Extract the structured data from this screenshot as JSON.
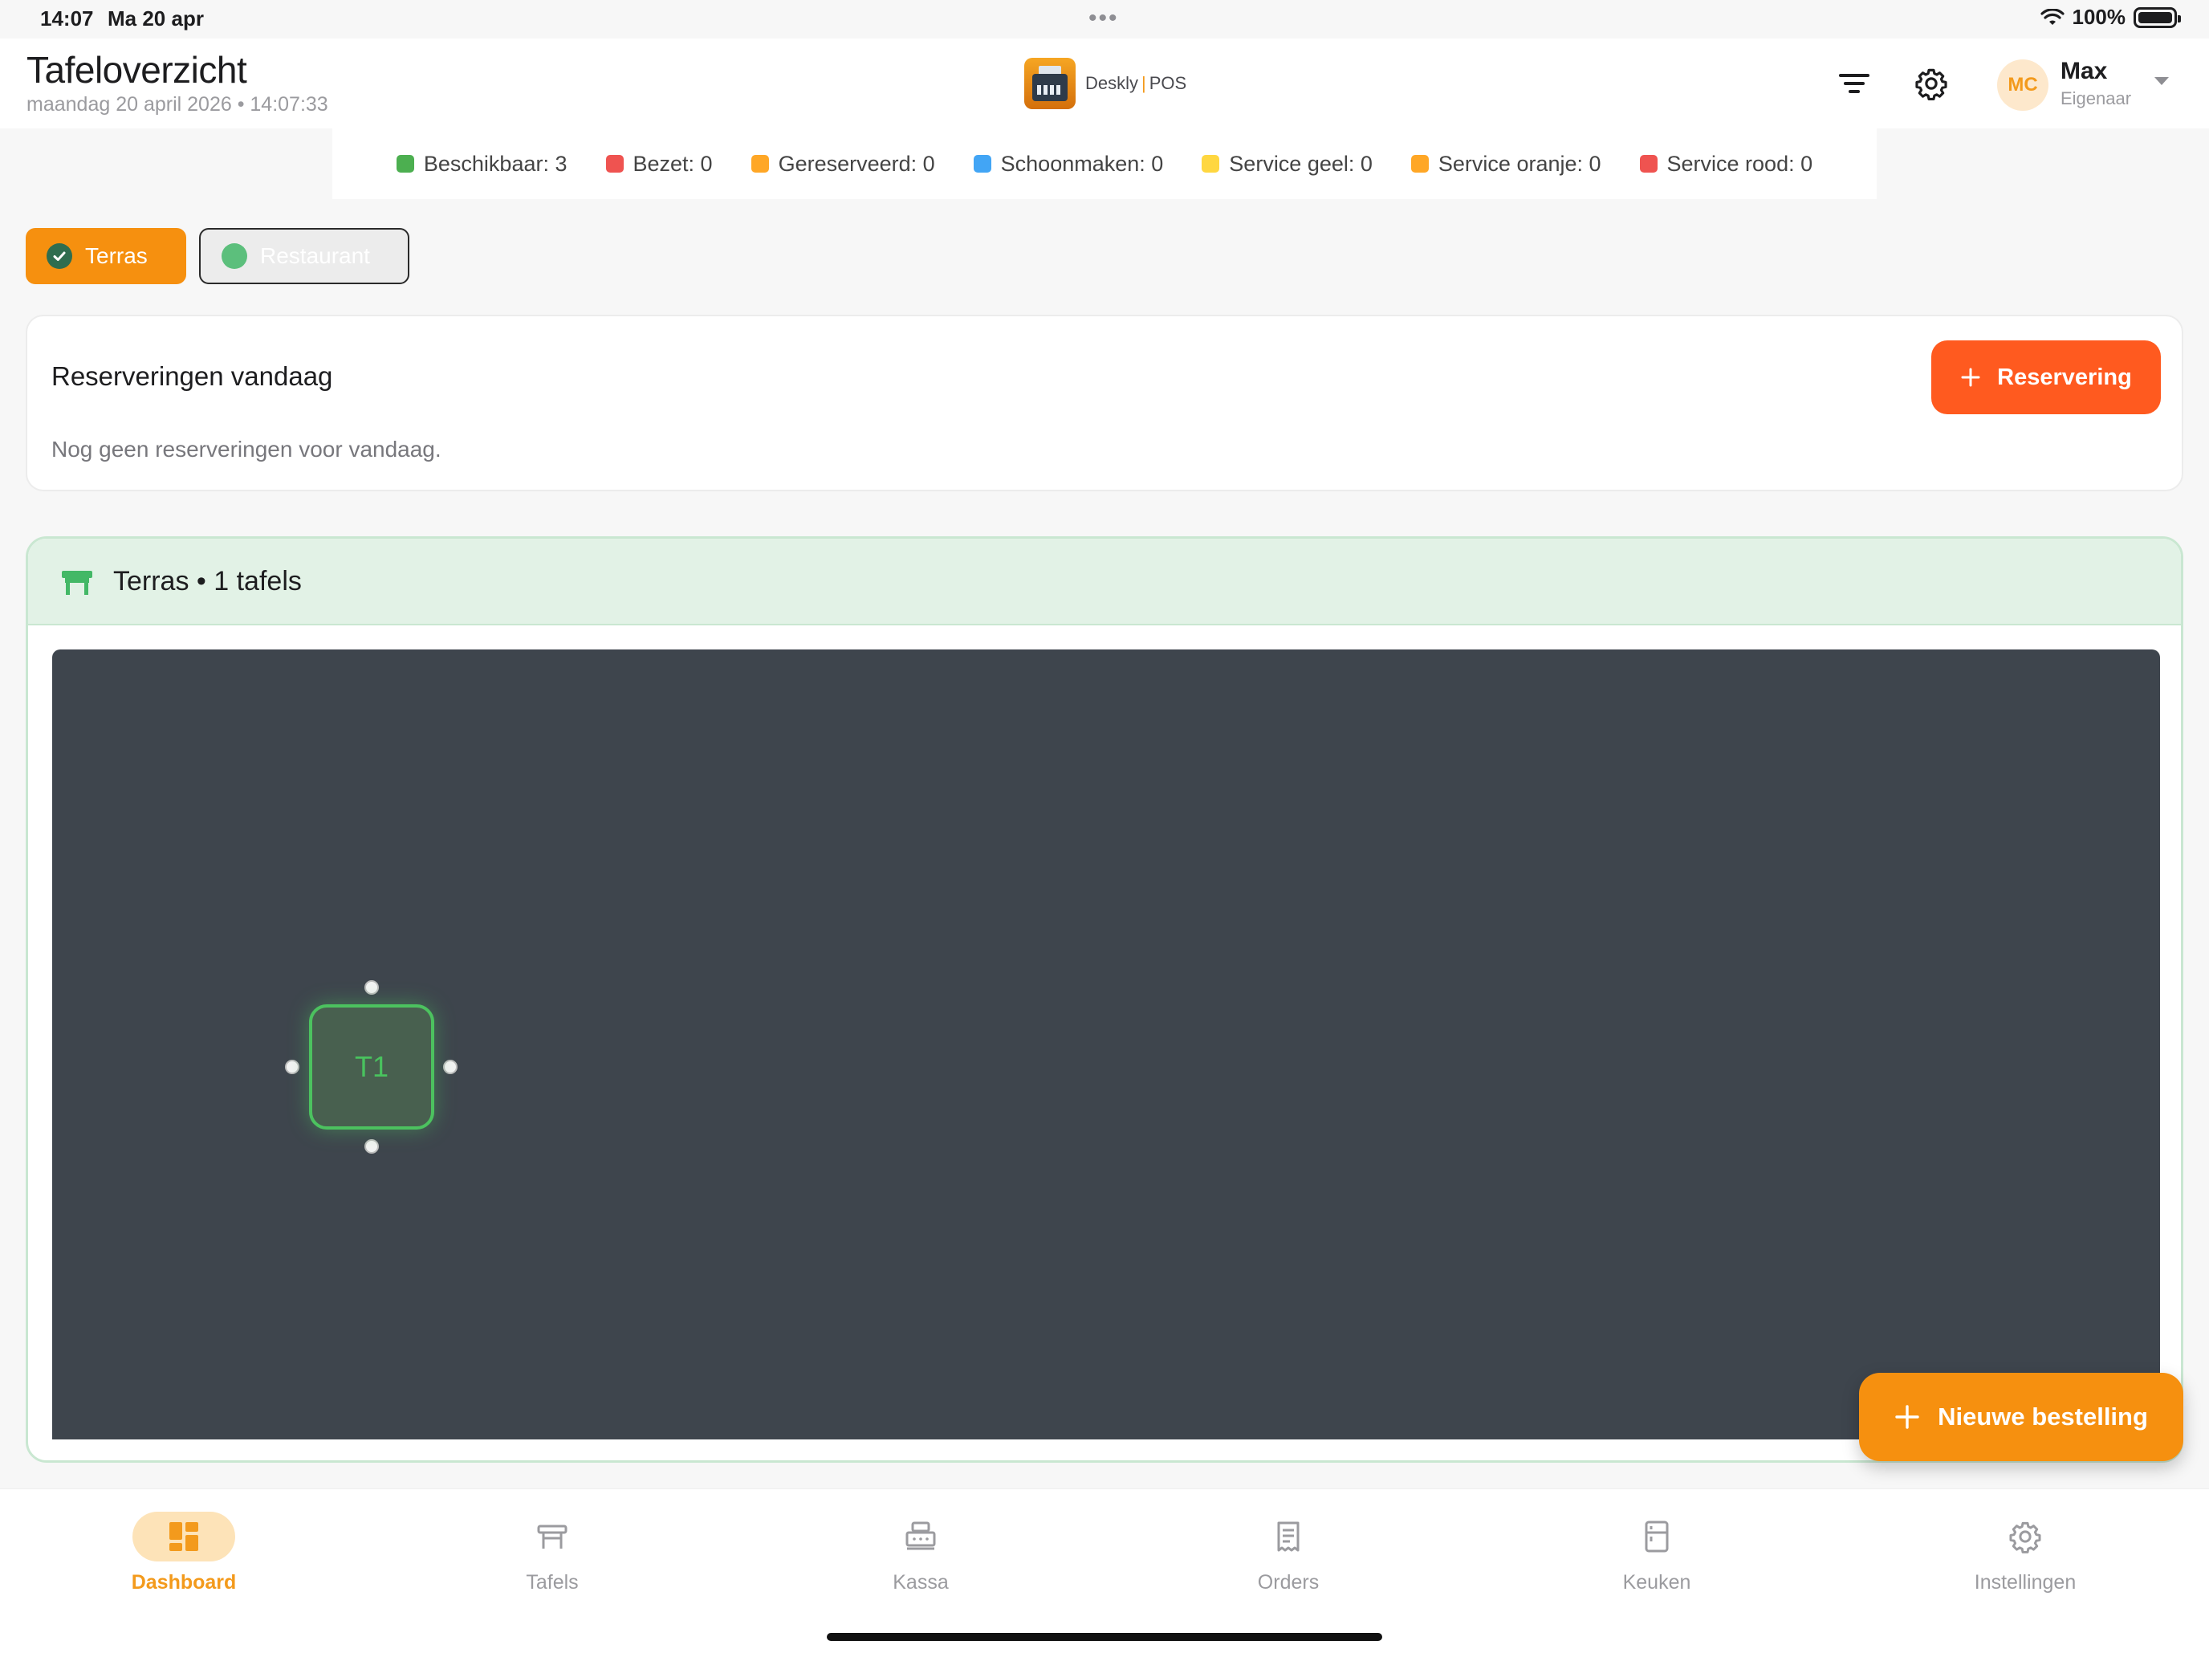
{
  "status_bar": {
    "time": "14:07",
    "date": "Ma 20 apr",
    "battery": "100%"
  },
  "header": {
    "title": "Tafeloverzicht",
    "subtitle": "maandag 20 april 2026 • 14:07:33",
    "brand": {
      "name": "Deskly",
      "product": "POS",
      "icon": "cash-register-icon"
    },
    "filter_icon": "filter-icon",
    "settings_icon": "gear-icon",
    "user": {
      "initials": "MC",
      "name": "Max",
      "role": "Eigenaar"
    }
  },
  "legend": [
    {
      "label": "Beschikbaar: 3",
      "color": "#4caf50"
    },
    {
      "label": "Bezet: 0",
      "color": "#ef5350"
    },
    {
      "label": "Gereserveerd: 0",
      "color": "#ffa726"
    },
    {
      "label": "Schoonmaken: 0",
      "color": "#42a5f5"
    },
    {
      "label": "Service geel: 0",
      "color": "#ffd740"
    },
    {
      "label": "Service oranje: 0",
      "color": "#ffa726"
    },
    {
      "label": "Service rood: 0",
      "color": "#ef5350"
    }
  ],
  "areas": [
    {
      "label": "Terras",
      "selected": true
    },
    {
      "label": "Restaurant",
      "selected": false
    }
  ],
  "reservations": {
    "title": "Reserveringen vandaag",
    "empty_text": "Nog geen reserveringen voor vandaag.",
    "add_button": "Reservering"
  },
  "floor": {
    "title": "Terras • 1 tafels",
    "tables": [
      {
        "label": "T1",
        "status": "available"
      }
    ]
  },
  "fab_label": "Nieuwe bestelling",
  "tabs": [
    {
      "label": "Dashboard",
      "icon": "dashboard-icon",
      "active": true
    },
    {
      "label": "Tafels",
      "icon": "table-icon",
      "active": false
    },
    {
      "label": "Kassa",
      "icon": "cash-register-icon",
      "active": false
    },
    {
      "label": "Orders",
      "icon": "receipt-icon",
      "active": false
    },
    {
      "label": "Keuken",
      "icon": "fridge-icon",
      "active": false
    },
    {
      "label": "Instellingen",
      "icon": "gear-icon",
      "active": false
    }
  ],
  "colors": {
    "accent": "#f39a1c",
    "cta": "#ff5a1f",
    "canvas": "#3e454d",
    "available": "#4cc25f"
  }
}
